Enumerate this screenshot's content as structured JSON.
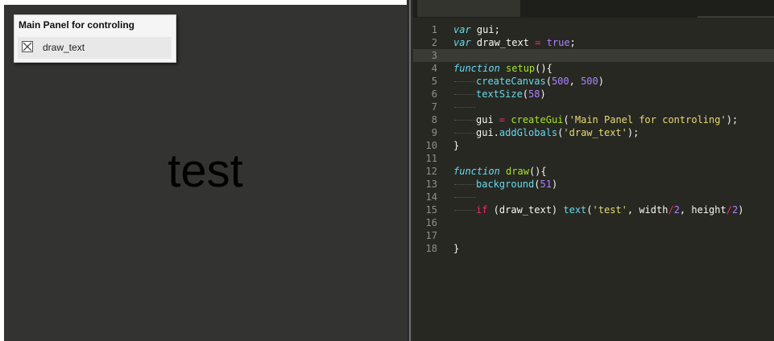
{
  "preview": {
    "gui_panel": {
      "title": "Main Panel for controling",
      "checkbox_label": "draw_text",
      "checked": true
    },
    "canvas_text": "test",
    "colors": {
      "canvas_bg": "#333331",
      "text": "#000000"
    }
  },
  "editor": {
    "line_numbers": [
      "1",
      "2",
      "3",
      "4",
      "5",
      "6",
      "7",
      "8",
      "9",
      "10",
      "11",
      "12",
      "13",
      "14",
      "15",
      "16",
      "17",
      "18"
    ],
    "colors": {
      "background": "#272822",
      "keyword": "#66d9ef",
      "function": "#a6e22e",
      "number": "#ae81ff",
      "string": "#e6db74",
      "operator": "#f92672",
      "text": "#f8f8f2"
    },
    "lines": [
      {
        "indent": 0,
        "tokens": [
          {
            "t": "var",
            "c": "kw"
          },
          {
            "t": " gui;",
            "c": "pl"
          }
        ]
      },
      {
        "indent": 0,
        "tokens": [
          {
            "t": "var",
            "c": "kw"
          },
          {
            "t": " draw_text ",
            "c": "pl"
          },
          {
            "t": "=",
            "c": "op"
          },
          {
            "t": " ",
            "c": "pl"
          },
          {
            "t": "true",
            "c": "num"
          },
          {
            "t": ";",
            "c": "pl"
          }
        ]
      },
      {
        "indent": 0,
        "tokens": []
      },
      {
        "indent": 0,
        "tokens": [
          {
            "t": "function",
            "c": "kw"
          },
          {
            "t": " ",
            "c": "pl"
          },
          {
            "t": "setup",
            "c": "fn"
          },
          {
            "t": "(){",
            "c": "pl"
          }
        ]
      },
      {
        "indent": 1,
        "tokens": [
          {
            "t": "createCanvas",
            "c": "bi"
          },
          {
            "t": "(",
            "c": "pl"
          },
          {
            "t": "500",
            "c": "num"
          },
          {
            "t": ", ",
            "c": "pl"
          },
          {
            "t": "500",
            "c": "num"
          },
          {
            "t": ")",
            "c": "pl"
          }
        ]
      },
      {
        "indent": 1,
        "tokens": [
          {
            "t": "textSize",
            "c": "bi"
          },
          {
            "t": "(",
            "c": "pl"
          },
          {
            "t": "58",
            "c": "num"
          },
          {
            "t": ")",
            "c": "pl"
          }
        ]
      },
      {
        "indent": 1,
        "tokens": []
      },
      {
        "indent": 1,
        "tokens": [
          {
            "t": "gui ",
            "c": "pl"
          },
          {
            "t": "=",
            "c": "op"
          },
          {
            "t": " ",
            "c": "pl"
          },
          {
            "t": "createGui",
            "c": "fn"
          },
          {
            "t": "(",
            "c": "pl"
          },
          {
            "t": "'Main Panel for controling'",
            "c": "str"
          },
          {
            "t": ");",
            "c": "pl"
          }
        ]
      },
      {
        "indent": 1,
        "tokens": [
          {
            "t": "gui.",
            "c": "pl"
          },
          {
            "t": "addGlobals",
            "c": "bi"
          },
          {
            "t": "(",
            "c": "pl"
          },
          {
            "t": "'draw_text'",
            "c": "str"
          },
          {
            "t": ");",
            "c": "pl"
          }
        ]
      },
      {
        "indent": 0,
        "tokens": [
          {
            "t": "}",
            "c": "pl"
          }
        ]
      },
      {
        "indent": 0,
        "tokens": []
      },
      {
        "indent": 0,
        "tokens": [
          {
            "t": "function",
            "c": "kw"
          },
          {
            "t": " ",
            "c": "pl"
          },
          {
            "t": "draw",
            "c": "fn"
          },
          {
            "t": "(){",
            "c": "pl"
          }
        ]
      },
      {
        "indent": 1,
        "tokens": [
          {
            "t": "background",
            "c": "bi"
          },
          {
            "t": "(",
            "c": "pl"
          },
          {
            "t": "51",
            "c": "num"
          },
          {
            "t": ")",
            "c": "pl"
          }
        ]
      },
      {
        "indent": 1,
        "tokens": []
      },
      {
        "indent": 1,
        "tokens": [
          {
            "t": "if",
            "c": "op"
          },
          {
            "t": " (draw_text) ",
            "c": "pl"
          },
          {
            "t": "text",
            "c": "bi"
          },
          {
            "t": "(",
            "c": "pl"
          },
          {
            "t": "'test'",
            "c": "str"
          },
          {
            "t": ", width",
            "c": "pl"
          },
          {
            "t": "/",
            "c": "op"
          },
          {
            "t": "2",
            "c": "num"
          },
          {
            "t": ", height",
            "c": "pl"
          },
          {
            "t": "/",
            "c": "op"
          },
          {
            "t": "2",
            "c": "num"
          },
          {
            "t": ")",
            "c": "pl"
          }
        ]
      },
      {
        "indent": 0,
        "tokens": []
      },
      {
        "indent": 0,
        "tokens": []
      },
      {
        "indent": 0,
        "tokens": [
          {
            "t": "}",
            "c": "pl"
          }
        ]
      }
    ]
  }
}
